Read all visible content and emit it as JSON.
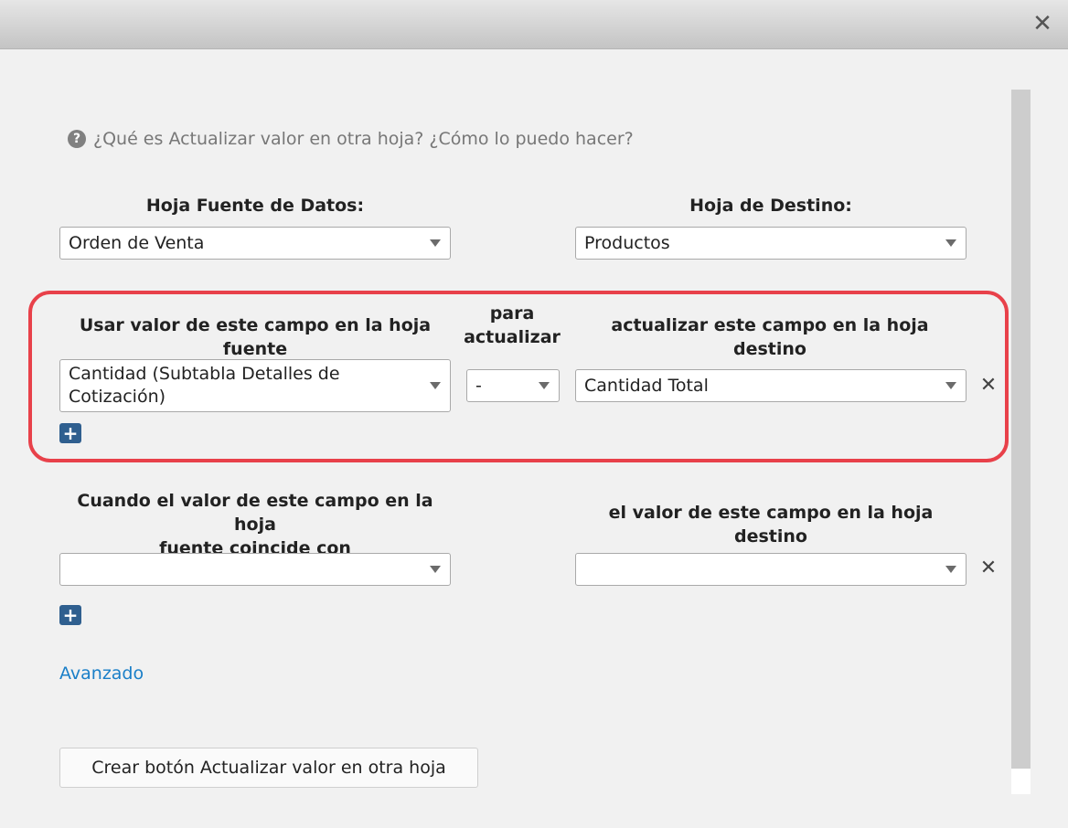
{
  "window": {
    "close_glyph": "✕"
  },
  "help": {
    "icon": "?",
    "text": "¿Qué es Actualizar valor en otra hoja? ¿Cómo lo puedo hacer?"
  },
  "sheets": {
    "source_label": "Hoja Fuente de Datos:",
    "source_value": "Orden de Venta",
    "dest_label": "Hoja de Destino:",
    "dest_value": "Productos"
  },
  "mapping": {
    "source_field_label": "Usar valor de este campo en la hoja fuente",
    "operator_label_line1": "para",
    "operator_label_line2": "actualizar",
    "dest_field_label": "actualizar este campo en la hoja destino",
    "rows": [
      {
        "source": "Cantidad (Subtabla Detalles de Cotización)",
        "operator": "-",
        "dest": "Cantidad Total"
      }
    ],
    "add_label": "+",
    "remove_label": "✕"
  },
  "match": {
    "source_label_line1": "Cuando el valor de este campo en la hoja",
    "source_label_line2": "fuente coincide con",
    "dest_label": "el valor de este campo en la hoja destino",
    "rows": [
      {
        "source": "",
        "dest": ""
      }
    ],
    "add_label": "+",
    "remove_label": "✕"
  },
  "advanced_link": "Avanzado",
  "create_button": "Crear botón Actualizar valor en otra hoja"
}
